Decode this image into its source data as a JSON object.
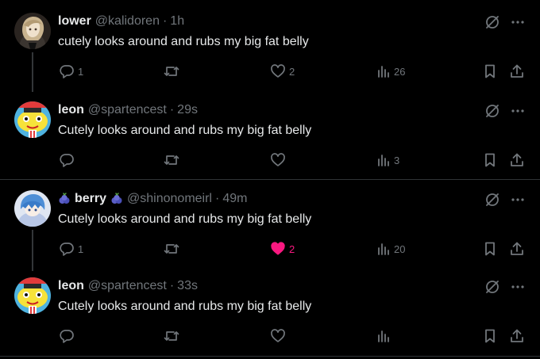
{
  "posts": [
    {
      "display_name": "lower",
      "handle": "@kalidoren",
      "separator": "·",
      "time": "1h",
      "text": "cutely looks around and rubs my big fat belly",
      "replies": "1",
      "reposts": "",
      "likes": "2",
      "views": "26",
      "liked": false
    },
    {
      "display_name": "leon",
      "handle": "@spartencest",
      "separator": "·",
      "time": "29s",
      "text": "Cutely looks around and rubs my big fat belly",
      "replies": "",
      "reposts": "",
      "likes": "",
      "views": "3",
      "liked": false
    },
    {
      "display_name": "berry",
      "handle": "@shinonomeirl",
      "separator": "·",
      "time": "49m",
      "text": "Cutely looks around and rubs my big fat belly",
      "replies": "1",
      "reposts": "",
      "likes": "2",
      "views": "20",
      "liked": true
    },
    {
      "display_name": "leon",
      "handle": "@spartencest",
      "separator": "·",
      "time": "33s",
      "text": "Cutely looks around and rubs my big fat belly",
      "replies": "",
      "reposts": "",
      "likes": "",
      "views": "",
      "liked": false
    }
  ],
  "colors": {
    "background": "#000000",
    "text": "#e7e9ea",
    "muted": "#71767b",
    "like": "#f91880",
    "divider": "#2f3336"
  }
}
